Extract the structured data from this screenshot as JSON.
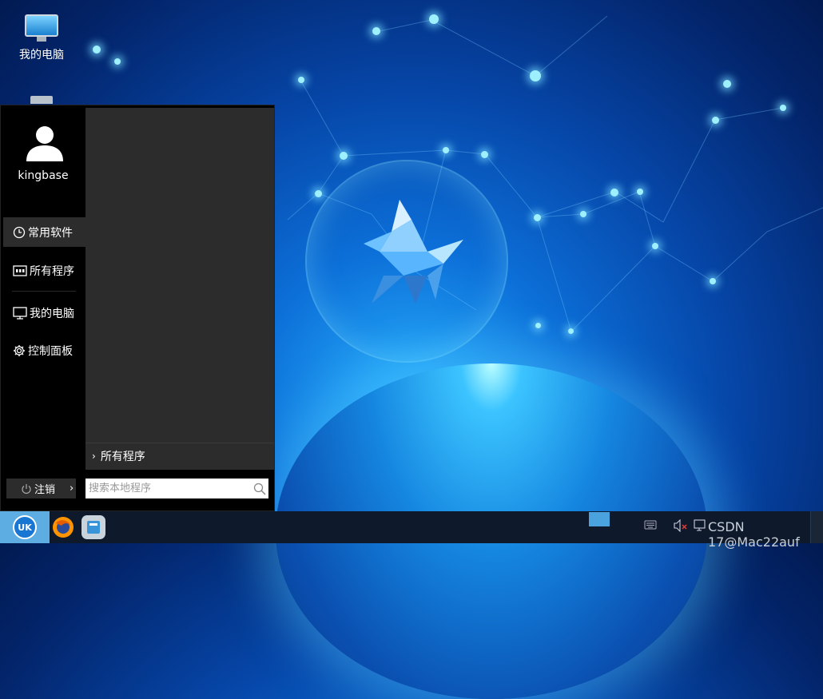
{
  "desktop": {
    "icons": [
      {
        "label": "我的电脑",
        "icon": "computer-icon"
      },
      {
        "label": "",
        "icon": "trash-icon"
      }
    ]
  },
  "start_menu": {
    "username": "kingbase",
    "sidebar": {
      "items": [
        {
          "label": "常用软件",
          "icon": "clock-icon",
          "active": true
        },
        {
          "label": "所有程序",
          "icon": "apps-icon",
          "active": false
        },
        {
          "label": "我的电脑",
          "icon": "monitor-icon",
          "active": false
        },
        {
          "label": "控制面板",
          "icon": "gear-icon",
          "active": false
        }
      ]
    },
    "all_programs_label": "所有程序",
    "logout_label": "注销",
    "search_placeholder": "搜索本地程序"
  },
  "taskbar": {
    "apps": [
      {
        "icon": "kylin-start-icon"
      },
      {
        "icon": "firefox-icon"
      },
      {
        "icon": "file-manager-icon"
      }
    ],
    "tray": {
      "icons": [
        "keyboard-icon",
        "volume-muted-icon",
        "network-icon"
      ],
      "clock_text": "CSDN 17@Mac22auf"
    }
  },
  "colors": {
    "menu_bg": "#000000",
    "panel_bg": "#2c2c2c",
    "taskbar_bg": "#0e1a2b",
    "start_button": "#5dade2",
    "accent": "#1976d2"
  }
}
